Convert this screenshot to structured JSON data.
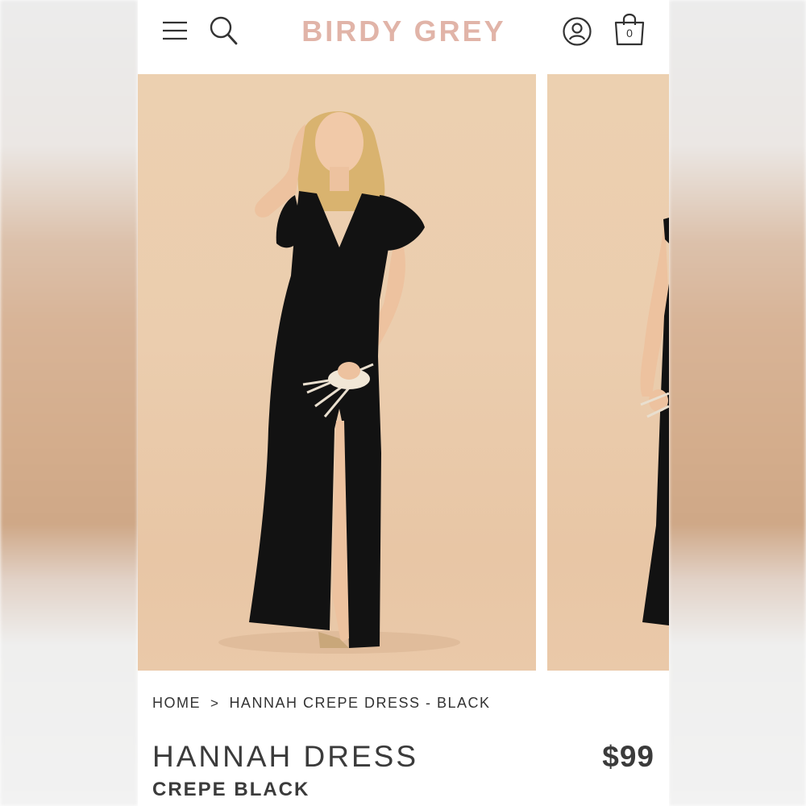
{
  "header": {
    "brand": "BIRDY GREY",
    "menu_icon": "hamburger-menu-icon",
    "search_icon": "search-icon",
    "account_icon": "account-icon",
    "bag_icon": "shopping-bag-icon",
    "bag_count": "0",
    "brand_color": "#e1b4a8"
  },
  "gallery": {
    "backdrop_color": "#ecd0b0",
    "dress_color": "#111111"
  },
  "breadcrumb": {
    "home": "HOME",
    "separator": ">",
    "current": "HANNAH CREPE DRESS - BLACK"
  },
  "product": {
    "name": "HANNAH DRESS",
    "variant": "CREPE BLACK",
    "price": "$99"
  }
}
